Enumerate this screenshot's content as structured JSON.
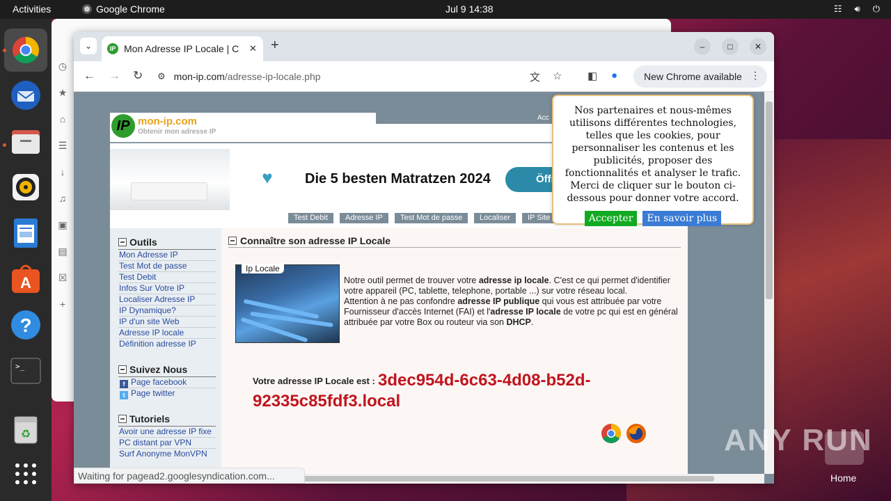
{
  "topbar": {
    "activities": "Activities",
    "app_name": "Google Chrome",
    "clock": "Jul 9  14:38"
  },
  "dock": {
    "items": [
      "chrome-icon",
      "thunderbird-icon",
      "files-icon",
      "rhythmbox-icon",
      "writer-icon",
      "app-center-icon",
      "help-icon",
      "terminal-icon",
      "trash-icon",
      "show-apps-icon"
    ]
  },
  "browser": {
    "tab_title": "Mon Adresse IP Locale | C",
    "url_host": "mon-ip.com",
    "url_path": "/adresse-ip-locale.php",
    "update_label": "New Chrome available",
    "status_text": "Waiting for pagead2.googlesyndication.com..."
  },
  "site": {
    "name": "mon-ip.com",
    "tagline": "Obtenir mon adresse IP",
    "logo_text": "IP",
    "header_link": "Acc",
    "ad": {
      "headline": "Die 5 besten Matratzen 2024",
      "button": "Öffn"
    },
    "menu": [
      "Test Debit",
      "Adresse IP",
      "Test Mot de passe",
      "Localiser",
      "IP Site"
    ],
    "nav": {
      "outils_title": "Outils",
      "outils": [
        "Mon Adresse IP",
        "Test Mot de passe",
        "Test Debit",
        "Infos Sur Votre IP",
        "Localiser Adresse IP",
        "IP Dynamique?",
        "IP d'un site Web",
        "Adresse IP locale",
        "Définition adresse IP"
      ],
      "suivez_title": "Suivez Nous",
      "suivez": [
        "Page facebook",
        "Page twitter"
      ],
      "tutoriels_title": "Tutoriels",
      "tutoriels": [
        "Avoir une adresse IP fixe",
        "PC distant par VPN",
        "Surf Anonyme MonVPN"
      ]
    },
    "main": {
      "title": "Connaître son adresse IP Locale",
      "photo_label": "Ip Locale",
      "p1_a": "Notre outil permet de trouver votre ",
      "p1_b": "adresse ip locale",
      "p1_c": ". C'est ce qui permet d'identifier votre appareil (PC, tablette, telephone, portable ...) sur votre réseau local.",
      "p2_a": "Attention à ne pas confondre ",
      "p2_b": "adresse IP publique",
      "p2_c": " qui vous est attribuée par votre Fournisseur d'accès Internet (FAI) et l'",
      "p2_d": "adresse IP locale",
      "p2_e": " de votre pc qui est en général attribuée par votre Box ou routeur via son ",
      "p2_f": "DHCP",
      "p2_g": ".",
      "ip_label": "Votre adresse IP Locale est : ",
      "ip_value": "3dec954d-6c63-4d08-b52d-92335c85fdf3.local"
    },
    "cookie": {
      "text": "Nos partenaires et nous-mêmes utilisons différentes technologies, telles que les cookies, pour personnaliser les contenus et les publicités, proposer des fonctionnalités et analyser le trafic. Merci de cliquer sur le bouton ci-dessous pour donner votre accord.",
      "accept": "Accepter",
      "more": "En savoir plus"
    }
  },
  "desktop": {
    "watermark": "ANY RUN",
    "home_label": "Home"
  }
}
